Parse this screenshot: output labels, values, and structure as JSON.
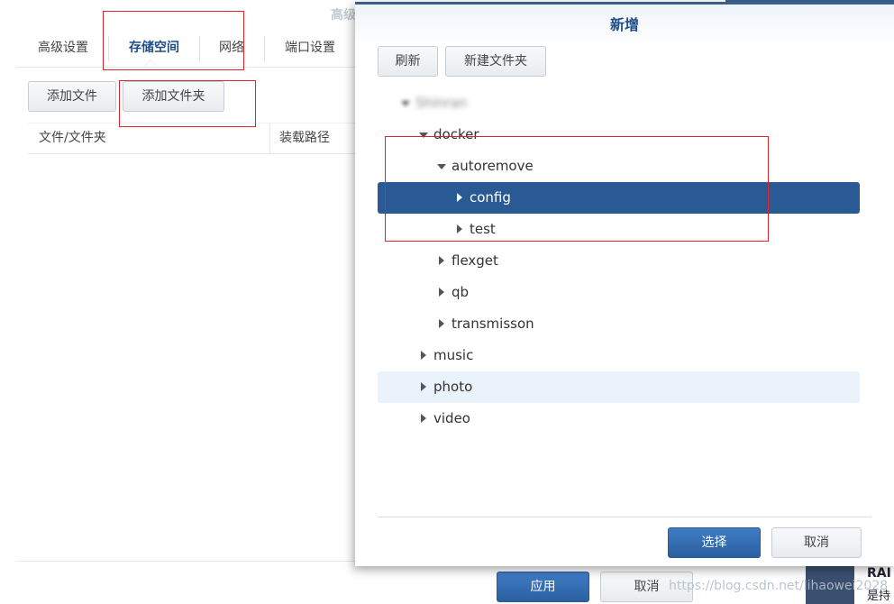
{
  "background": {
    "title": "高级",
    "tabs": [
      "高级设置",
      "存储空间",
      "网络",
      "端口设置"
    ],
    "active_tab": "存储空间",
    "add_file": "添加文件",
    "add_folder": "添加文件夹",
    "columns": [
      "文件/文件夹",
      "装载路径"
    ],
    "apply": "应用",
    "cancel": "取消"
  },
  "modal": {
    "title": "新增",
    "refresh": "刷新",
    "new_folder": "新建文件夹",
    "tree": [
      {
        "label": "Shinran",
        "level": 0,
        "expanded": true,
        "blurred": true
      },
      {
        "label": "docker",
        "level": 1,
        "expanded": true
      },
      {
        "label": "autoremove",
        "level": 2,
        "expanded": true
      },
      {
        "label": "config",
        "level": 3,
        "expanded": false,
        "selected": true
      },
      {
        "label": "test",
        "level": 3,
        "expanded": false
      },
      {
        "label": "flexget",
        "level": 2,
        "expanded": false
      },
      {
        "label": "qb",
        "level": 2,
        "expanded": false
      },
      {
        "label": "transmisson",
        "level": 2,
        "expanded": false
      },
      {
        "label": "music",
        "level": 1,
        "expanded": false
      },
      {
        "label": "photo",
        "level": 1,
        "expanded": false,
        "hover": true
      },
      {
        "label": "video",
        "level": 1,
        "expanded": false
      }
    ],
    "select": "选择",
    "cancel": "取消"
  },
  "right_partial": {
    "text1": "RAI",
    "text2": "是持"
  },
  "watermark": "https://blog.csdn.net/lihaowei2028",
  "colors": {
    "accent": "#2a5a94",
    "highlight_box": "#d9262c",
    "title": "#1f4e87"
  }
}
